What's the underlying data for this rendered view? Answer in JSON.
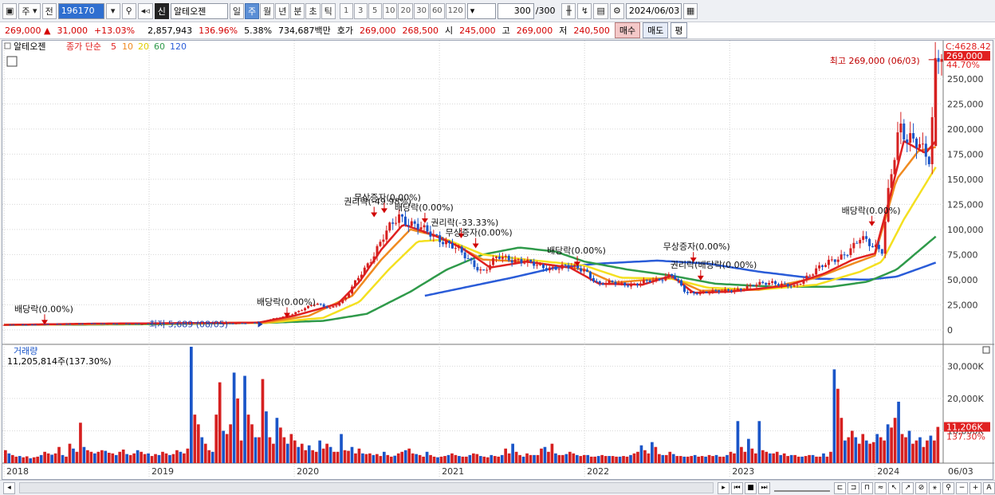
{
  "toolbar": {
    "period_label": "주",
    "prev_label": "전",
    "stock_code": "196170",
    "badge_sin": "신",
    "stock_name": "알테오젠",
    "intervals": [
      "일",
      "주",
      "월",
      "년",
      "분",
      "초",
      "틱"
    ],
    "selected_interval": "주",
    "minute_steps": [
      "1",
      "3",
      "5",
      "10",
      "20",
      "30",
      "60",
      "120"
    ],
    "count_value": "300",
    "count_total": "/300",
    "date_value": "2024/06/03"
  },
  "quote": {
    "price": "269,000",
    "change": "31,000",
    "change_pct": "+13.03%",
    "volume": "2,857,943",
    "vol_ratio": "136.96%",
    "turnover": "5.38%",
    "amount": "734,687백만",
    "hoga_label": "호가",
    "ask": "269,000",
    "bid": "268,500",
    "open_label": "시",
    "open": "245,000",
    "high_label": "고",
    "high": "269,000",
    "low_label": "저",
    "low": "240,500",
    "buy_label": "매수",
    "sell_label": "매도",
    "avg_label": "평"
  },
  "legend": {
    "name": "알테오젠",
    "prefix": "종가 단순",
    "ma5": "5",
    "ma10": "10",
    "ma20": "20",
    "ma60": "60",
    "ma120": "120"
  },
  "volume_panel": {
    "title": "거래량",
    "value": "11,205,814주(137.30%)"
  },
  "colors": {
    "up": "#d62020",
    "down": "#1a55c8",
    "ma5": "#e02020",
    "ma10": "#f08a20",
    "ma20": "#f4e020",
    "ma60": "#2f9a4a",
    "ma120": "#2a5cd8"
  },
  "chart_data": [
    {
      "type": "candlestick",
      "x_labels": [
        "2018",
        "2019",
        "2020",
        "2021",
        "2022",
        "2023",
        "2024",
        "06/03"
      ],
      "y_ticks": [
        0,
        25000,
        50000,
        75000,
        100000,
        125000,
        150000,
        175000,
        200000,
        225000,
        250000
      ],
      "y_tick_labels": [
        "0",
        "25,000",
        "50,000",
        "75,000",
        "100,000",
        "125,000",
        "150,000",
        "175,000",
        "200,000",
        "225,000",
        "250,000"
      ],
      "ylim": [
        -12000,
        280000
      ],
      "top_label": "C:4628.42",
      "last_price_label": "269,000",
      "last_pct_label": "44.70%",
      "high_annotation": "최고 269,000 (06/03)",
      "low_annotation": "최저 5,689 (08/05)",
      "price_path": [
        [
          2018.0,
          5000
        ],
        [
          2018.3,
          5600
        ],
        [
          2018.6,
          6300
        ],
        [
          2018.9,
          6000
        ],
        [
          2019.3,
          7000
        ],
        [
          2019.6,
          6200
        ],
        [
          2019.75,
          7400
        ],
        [
          2019.95,
          14000
        ],
        [
          2020.05,
          20000
        ],
        [
          2020.15,
          26000
        ],
        [
          2020.25,
          22000
        ],
        [
          2020.35,
          30000
        ],
        [
          2020.45,
          55000
        ],
        [
          2020.55,
          75000
        ],
        [
          2020.65,
          100000
        ],
        [
          2020.72,
          115000
        ],
        [
          2020.8,
          106000
        ],
        [
          2020.9,
          98000
        ],
        [
          2021.0,
          92000
        ],
        [
          2021.1,
          82000
        ],
        [
          2021.2,
          70000
        ],
        [
          2021.3,
          58000
        ],
        [
          2021.4,
          72000
        ],
        [
          2021.55,
          70000
        ],
        [
          2021.7,
          62000
        ],
        [
          2021.85,
          63000
        ],
        [
          2022.0,
          60000
        ],
        [
          2022.1,
          45000
        ],
        [
          2022.2,
          47000
        ],
        [
          2022.35,
          45000
        ],
        [
          2022.5,
          50000
        ],
        [
          2022.6,
          56000
        ],
        [
          2022.7,
          36000
        ],
        [
          2022.8,
          38000
        ],
        [
          2022.95,
          38000
        ],
        [
          2023.1,
          42000
        ],
        [
          2023.3,
          48000
        ],
        [
          2023.45,
          42000
        ],
        [
          2023.6,
          62000
        ],
        [
          2023.75,
          70000
        ],
        [
          2023.9,
          92000
        ],
        [
          2023.98,
          82000
        ],
        [
          2024.05,
          80000
        ],
        [
          2024.1,
          150000
        ],
        [
          2024.17,
          200000
        ],
        [
          2024.22,
          185000
        ],
        [
          2024.3,
          190000
        ],
        [
          2024.38,
          172000
        ],
        [
          2024.42,
          269000
        ]
      ],
      "ma_series": {
        "ma5": [
          [
            2018.0,
            5000
          ],
          [
            2018.6,
            6200
          ],
          [
            2019.3,
            6800
          ],
          [
            2019.75,
            7200
          ],
          [
            2020.0,
            14000
          ],
          [
            2020.3,
            26000
          ],
          [
            2020.45,
            48000
          ],
          [
            2020.6,
            80000
          ],
          [
            2020.75,
            105000
          ],
          [
            2020.95,
            95000
          ],
          [
            2021.15,
            82000
          ],
          [
            2021.35,
            62000
          ],
          [
            2021.6,
            68000
          ],
          [
            2021.9,
            62000
          ],
          [
            2022.1,
            46000
          ],
          [
            2022.4,
            45000
          ],
          [
            2022.6,
            54000
          ],
          [
            2022.75,
            37000
          ],
          [
            2023.0,
            38000
          ],
          [
            2023.4,
            44000
          ],
          [
            2023.65,
            56000
          ],
          [
            2023.85,
            70000
          ],
          [
            2024.0,
            76000
          ],
          [
            2024.1,
            130000
          ],
          [
            2024.2,
            188000
          ],
          [
            2024.35,
            176000
          ],
          [
            2024.42,
            188000
          ]
        ],
        "ma10": [
          [
            2018.0,
            5000
          ],
          [
            2019.0,
            6400
          ],
          [
            2019.8,
            7400
          ],
          [
            2020.1,
            14000
          ],
          [
            2020.4,
            34000
          ],
          [
            2020.6,
            70000
          ],
          [
            2020.8,
            100000
          ],
          [
            2021.0,
            93000
          ],
          [
            2021.3,
            70000
          ],
          [
            2021.6,
            68000
          ],
          [
            2022.0,
            60000
          ],
          [
            2022.2,
            47000
          ],
          [
            2022.6,
            52000
          ],
          [
            2022.8,
            39000
          ],
          [
            2023.2,
            40000
          ],
          [
            2023.6,
            52000
          ],
          [
            2023.85,
            66000
          ],
          [
            2024.0,
            74000
          ],
          [
            2024.15,
            150000
          ],
          [
            2024.3,
            178000
          ],
          [
            2024.42,
            182000
          ]
        ],
        "ma20": [
          [
            2018.0,
            5000
          ],
          [
            2019.0,
            6200
          ],
          [
            2019.8,
            7000
          ],
          [
            2020.2,
            12000
          ],
          [
            2020.45,
            28000
          ],
          [
            2020.65,
            60000
          ],
          [
            2020.85,
            88000
          ],
          [
            2021.05,
            90000
          ],
          [
            2021.3,
            75000
          ],
          [
            2021.6,
            70000
          ],
          [
            2022.0,
            64000
          ],
          [
            2022.25,
            52000
          ],
          [
            2022.6,
            51000
          ],
          [
            2022.85,
            42000
          ],
          [
            2023.2,
            40000
          ],
          [
            2023.6,
            45000
          ],
          [
            2023.9,
            58000
          ],
          [
            2024.05,
            68000
          ],
          [
            2024.2,
            110000
          ],
          [
            2024.42,
            162000
          ]
        ],
        "ma60": [
          [
            2018.0,
            5000
          ],
          [
            2019.0,
            5600
          ],
          [
            2019.8,
            7000
          ],
          [
            2020.2,
            9000
          ],
          [
            2020.5,
            16000
          ],
          [
            2020.8,
            38000
          ],
          [
            2021.05,
            60000
          ],
          [
            2021.3,
            75000
          ],
          [
            2021.55,
            82000
          ],
          [
            2021.8,
            78000
          ],
          [
            2022.0,
            68000
          ],
          [
            2022.3,
            60000
          ],
          [
            2022.6,
            54000
          ],
          [
            2022.9,
            46000
          ],
          [
            2023.3,
            43000
          ],
          [
            2023.7,
            43000
          ],
          [
            2023.95,
            48000
          ],
          [
            2024.15,
            60000
          ],
          [
            2024.42,
            93000
          ]
        ],
        "ma120": [
          [
            2020.9,
            34000
          ],
          [
            2021.2,
            43000
          ],
          [
            2021.5,
            52000
          ],
          [
            2021.8,
            62000
          ],
          [
            2022.1,
            66000
          ],
          [
            2022.5,
            69000
          ],
          [
            2022.85,
            66000
          ],
          [
            2023.2,
            58000
          ],
          [
            2023.6,
            51000
          ],
          [
            2023.95,
            50000
          ],
          [
            2024.15,
            53000
          ],
          [
            2024.42,
            67000
          ]
        ]
      },
      "annotations": [
        {
          "x": 2018.28,
          "y": 6000,
          "text": "배당락(0.00%)"
        },
        {
          "x": 2019.95,
          "y": 13000,
          "text": "배당락(0.00%)"
        },
        {
          "x": 2020.55,
          "y": 113000,
          "text": "권리락(-49.98%)"
        },
        {
          "x": 2020.62,
          "y": 117000,
          "text": "무상증자(0.00%)"
        },
        {
          "x": 2020.9,
          "y": 107000,
          "text": "배당락(0.00%)"
        },
        {
          "x": 2021.15,
          "y": 92000,
          "text": "권리락(-33.33%)"
        },
        {
          "x": 2021.25,
          "y": 82000,
          "text": "무상증자(0.00%)"
        },
        {
          "x": 2021.95,
          "y": 64000,
          "text": "배당락(0.00%)"
        },
        {
          "x": 2022.75,
          "y": 68000,
          "text": "무상증자(0.00%)"
        },
        {
          "x": 2022.8,
          "y": 50000,
          "text": "권리락(배당락(0.00%)"
        },
        {
          "x": 2023.98,
          "y": 104000,
          "text": "배당락(0.00%)"
        }
      ]
    },
    {
      "type": "bar",
      "title": "거래량",
      "y_tick_labels": [
        "10,000K",
        "20,000K",
        "30,000K"
      ],
      "ylim": [
        0,
        36000
      ],
      "last_label": "11,206K",
      "last_pct": "137.30%",
      "values_k": [
        4000,
        3000,
        2500,
        2000,
        2200,
        1800,
        2100,
        1500,
        1800,
        2000,
        2500,
        3500,
        3000,
        2600,
        3000,
        5000,
        2500,
        2000,
        6000,
        4500,
        3500,
        12500,
        5000,
        4000,
        3500,
        3000,
        3500,
        4000,
        3800,
        3200,
        3000,
        2500,
        3500,
        4200,
        2800,
        2500,
        3000,
        4000,
        3500,
        2800,
        3000,
        2200,
        2800,
        2500,
        3500,
        3000,
        2500,
        2800,
        4000,
        3500,
        3000,
        4500,
        36000,
        15000,
        12000,
        8000,
        6000,
        4000,
        3500,
        15000,
        25000,
        10000,
        9000,
        12000,
        28000,
        20000,
        7000,
        27000,
        15000,
        12000,
        8000,
        8000,
        26000,
        16000,
        8000,
        6000,
        14000,
        11000,
        8000,
        6000,
        9000,
        7000,
        5000,
        6000,
        4000,
        5500,
        4000,
        3500,
        7000,
        4500,
        6000,
        5000,
        3500,
        3500,
        9000,
        4000,
        3800,
        5000,
        3000,
        4500,
        3000,
        2800,
        3000,
        2500,
        2800,
        2200,
        3500,
        2500,
        2000,
        2300,
        3000,
        3500,
        4000,
        4500,
        3000,
        2800,
        2500,
        2000,
        3500,
        2500,
        2000,
        1800,
        2000,
        2200,
        2500,
        3000,
        2500,
        2200,
        2000,
        2000,
        2500,
        3000,
        2800,
        2200,
        2000,
        1800,
        2500,
        2200,
        2000,
        2500,
        4500,
        3000,
        6000,
        3500,
        2500,
        2000,
        3000,
        2500,
        2500,
        2500,
        4500,
        5000,
        3500,
        6000,
        3000,
        2500,
        2500,
        2800,
        3500,
        3000,
        2500,
        2200,
        2500,
        2500,
        2000,
        2000,
        2200,
        2500,
        2200,
        2200,
        2200,
        2000,
        2000,
        2200,
        2000,
        2500,
        3000,
        3500,
        5500,
        4000,
        3000,
        6500,
        5000,
        2800,
        2500,
        2500,
        3500,
        2800,
        2200,
        2200,
        2000,
        2000,
        2200,
        2500,
        2000,
        2200,
        2000,
        2500,
        2200,
        2500,
        2000,
        2000,
        2500,
        3500,
        3000,
        13000,
        5000,
        3500,
        7500,
        4500,
        3000,
        13000,
        4000,
        3500,
        3000,
        3000,
        3500,
        2500,
        3000,
        2200,
        2500,
        2500,
        2000,
        2000,
        2200,
        2500,
        2500,
        2000,
        2000,
        3000,
        2000,
        3500,
        29000,
        23000,
        14000,
        7000,
        8000,
        10000,
        8000,
        6000,
        9000,
        7000,
        6000,
        6500,
        9000,
        8000,
        7000,
        12000,
        11000,
        14000,
        19000,
        9000,
        8000,
        10000,
        6000,
        7000,
        8000,
        5000,
        7000,
        8500,
        7000,
        11206
      ],
      "volume_up_mask": "alternating"
    }
  ]
}
